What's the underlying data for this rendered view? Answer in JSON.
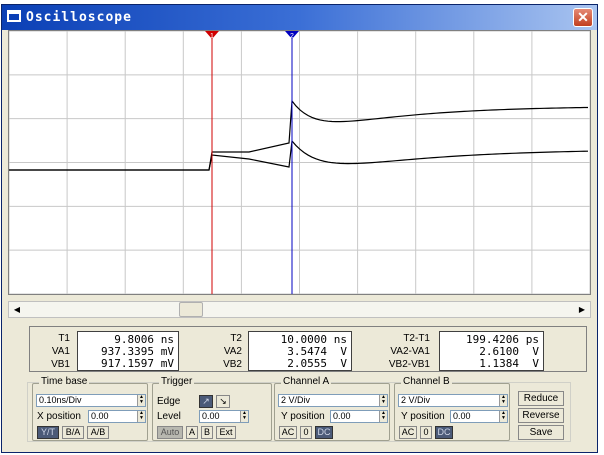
{
  "window": {
    "title": "Oscilloscope",
    "close_glyph": "✕"
  },
  "cursors": {
    "cursor1_label": "1",
    "cursor2_label": "2",
    "cursor1_color": "#d00000",
    "cursor2_color": "#0000c0"
  },
  "readout": {
    "t1": {
      "label": "T1",
      "value": "9.8006",
      "unit": "ns"
    },
    "va1": {
      "label": "VA1",
      "value": "937.3395",
      "unit": "mV"
    },
    "vb1": {
      "label": "VB1",
      "value": "917.1597",
      "unit": "mV"
    },
    "t2": {
      "label": "T2",
      "value": "10.0000",
      "unit": "ns"
    },
    "va2": {
      "label": "VA2",
      "value": "3.5474",
      "unit": "V"
    },
    "vb2": {
      "label": "VB2",
      "value": "2.0555",
      "unit": "V"
    },
    "dt": {
      "label": "T2-T1",
      "value": "199.4206",
      "unit": "ps"
    },
    "dva": {
      "label": "VA2-VA1",
      "value": "2.6100",
      "unit": "V"
    },
    "dvb": {
      "label": "VB2-VB1",
      "value": "1.1384",
      "unit": "V"
    }
  },
  "timebase": {
    "title": "Time base",
    "scale": "0.10ns/Div",
    "xpos_label": "X position",
    "xpos_value": "0.00",
    "modes": [
      "Y/T",
      "B/A",
      "A/B"
    ],
    "active_mode": "Y/T"
  },
  "trigger": {
    "title": "Trigger",
    "edge_label": "Edge",
    "level_label": "Level",
    "level_value": "0.00",
    "buttons": [
      "Auto",
      "A",
      "B",
      "Ext"
    ],
    "edge_rising_glyph": "↗",
    "edge_falling_glyph": "↘"
  },
  "channel_a": {
    "title": "Channel A",
    "scale": "2 V/Div",
    "ypos_label": "Y position",
    "ypos_value": "0.00",
    "coupling": [
      "AC",
      "0",
      "DC"
    ]
  },
  "channel_b": {
    "title": "Channel B",
    "scale": "2 V/Div",
    "ypos_label": "Y position",
    "ypos_value": "0.00",
    "coupling": [
      "AC",
      "0",
      "DC"
    ]
  },
  "side_buttons": {
    "reduce": "Reduce",
    "reverse": "Reverse",
    "save": "Save"
  },
  "scroll": {
    "left_glyph": "◀",
    "right_glyph": "▶"
  },
  "colors": {
    "trace": "#000000",
    "grid": "#c8c8c8",
    "screen_bg": "#ffffff"
  }
}
